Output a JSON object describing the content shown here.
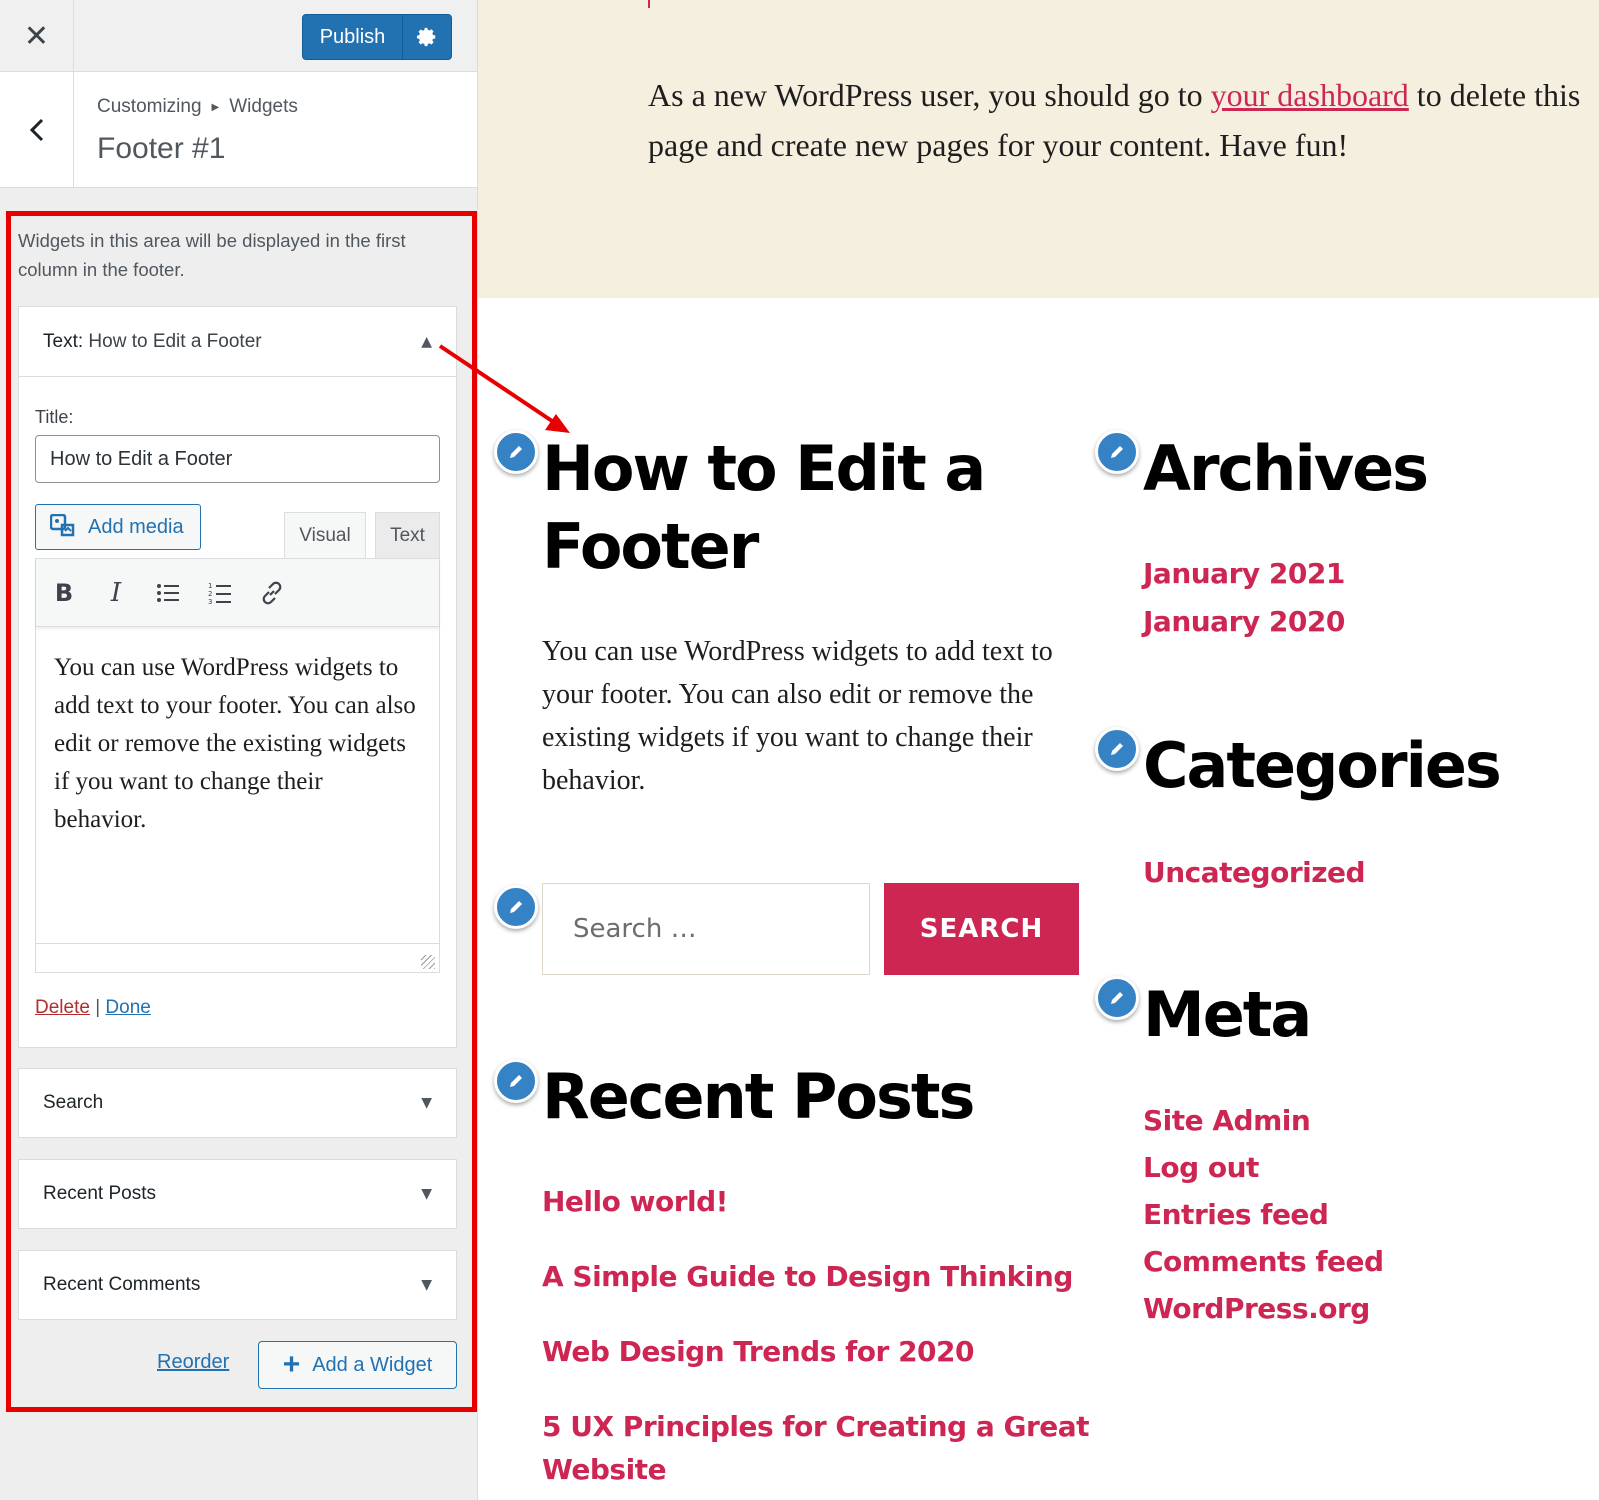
{
  "customizer": {
    "close_icon": "close-icon",
    "publish_label": "Publish",
    "settings_icon": "gear-icon",
    "breadcrumb": [
      "Customizing",
      "Widgets"
    ],
    "section_title": "Footer #1",
    "area_description": "Widgets in this area will be displayed in the first column in the footer.",
    "text_widget": {
      "type_label": "Text:",
      "name": "How to Edit a Footer",
      "title_label": "Title:",
      "title_value": "How to Edit a Footer",
      "add_media_label": "Add media",
      "tab_visual": "Visual",
      "tab_text": "Text",
      "toolbar": [
        "bold-icon",
        "italic-icon",
        "bulleted-list-icon",
        "numbered-list-icon",
        "link-icon"
      ],
      "content": "You can use WordPress widgets to add text to your footer. You can also edit or remove the existing widgets if you want to change their behavior.",
      "delete_label": "Delete",
      "separator": "|",
      "done_label": "Done"
    },
    "collapsed_widgets": [
      "Search",
      "Recent Posts",
      "Recent Comments"
    ],
    "reorder_label": "Reorder",
    "add_widget_label": "Add a Widget"
  },
  "preview": {
    "intro_before": "As a new WordPress user, you should go to ",
    "intro_link": "your dashboard",
    "intro_after": " to delete this page and create new pages for your content. Have fun!",
    "footer_widget": {
      "title_line1": "How to Edit a",
      "title_line2": "Footer",
      "text": "You can use WordPress widgets to add text to your footer. You can also edit or remove the existing widgets if you want to change their behavior."
    },
    "search": {
      "placeholder": "Search …",
      "button": "SEARCH"
    },
    "recent_posts": {
      "title": "Recent Posts",
      "items": [
        "Hello world!",
        "A Simple Guide to Design Thinking",
        "Web Design Trends for 2020",
        "5 UX Principles for Creating a Great",
        "Website"
      ]
    },
    "archives": {
      "title": "Archives",
      "items": [
        "January 2021",
        "January 2020"
      ]
    },
    "categories": {
      "title": "Categories",
      "items": [
        "Uncategorized"
      ]
    },
    "meta": {
      "title": "Meta",
      "items": [
        "Site Admin",
        "Log out",
        "Entries feed",
        "Comments feed",
        "WordPress.org"
      ]
    }
  },
  "colors": {
    "accent": "#cd2653",
    "wp_blue": "#2271b1",
    "highlight": "#e80000",
    "cream": "#f5efe0"
  }
}
